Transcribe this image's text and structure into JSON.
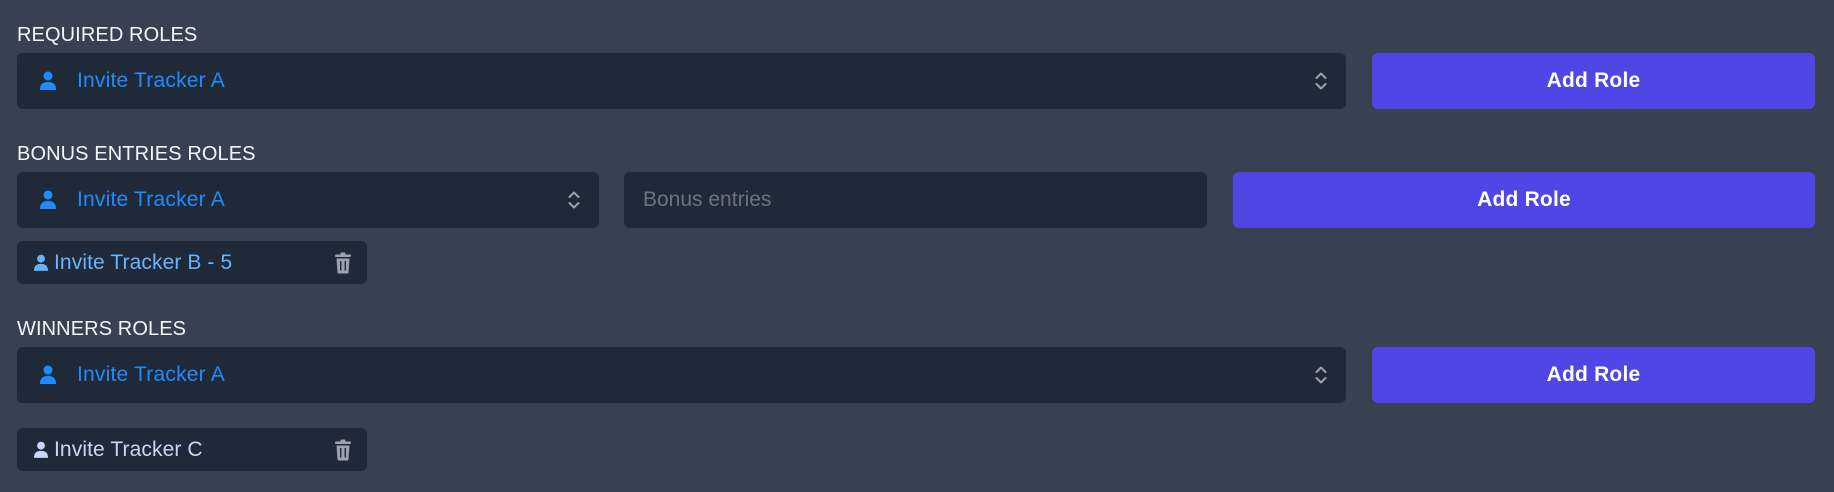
{
  "required_roles": {
    "label": "REQUIRED ROLES",
    "select_value": "Invite Tracker A",
    "add_button": "Add Role"
  },
  "bonus_entries_roles": {
    "label": "BONUS ENTRIES ROLES",
    "select_value": "Invite Tracker A",
    "input_placeholder": "Bonus entries",
    "input_value": "",
    "add_button": "Add Role",
    "items": [
      {
        "label": "Invite Tracker B - 5"
      }
    ]
  },
  "winners_roles": {
    "label": "WINNERS ROLES",
    "select_value": "Invite Tracker A",
    "add_button": "Add Role",
    "items": [
      {
        "label": "Invite Tracker C"
      }
    ]
  },
  "icons": {
    "select": "user-icon",
    "select_arrows": "chevron-up-down-icon",
    "chip": "user-icon",
    "remove": "trash-icon"
  },
  "colors": {
    "page_background": "#374151",
    "field_background": "#1f2937",
    "button": "#4f46e5",
    "select_text": "#1e8cff",
    "chip_b_text": "#66b3ff",
    "chip_c_text": "#c7d7f5"
  }
}
